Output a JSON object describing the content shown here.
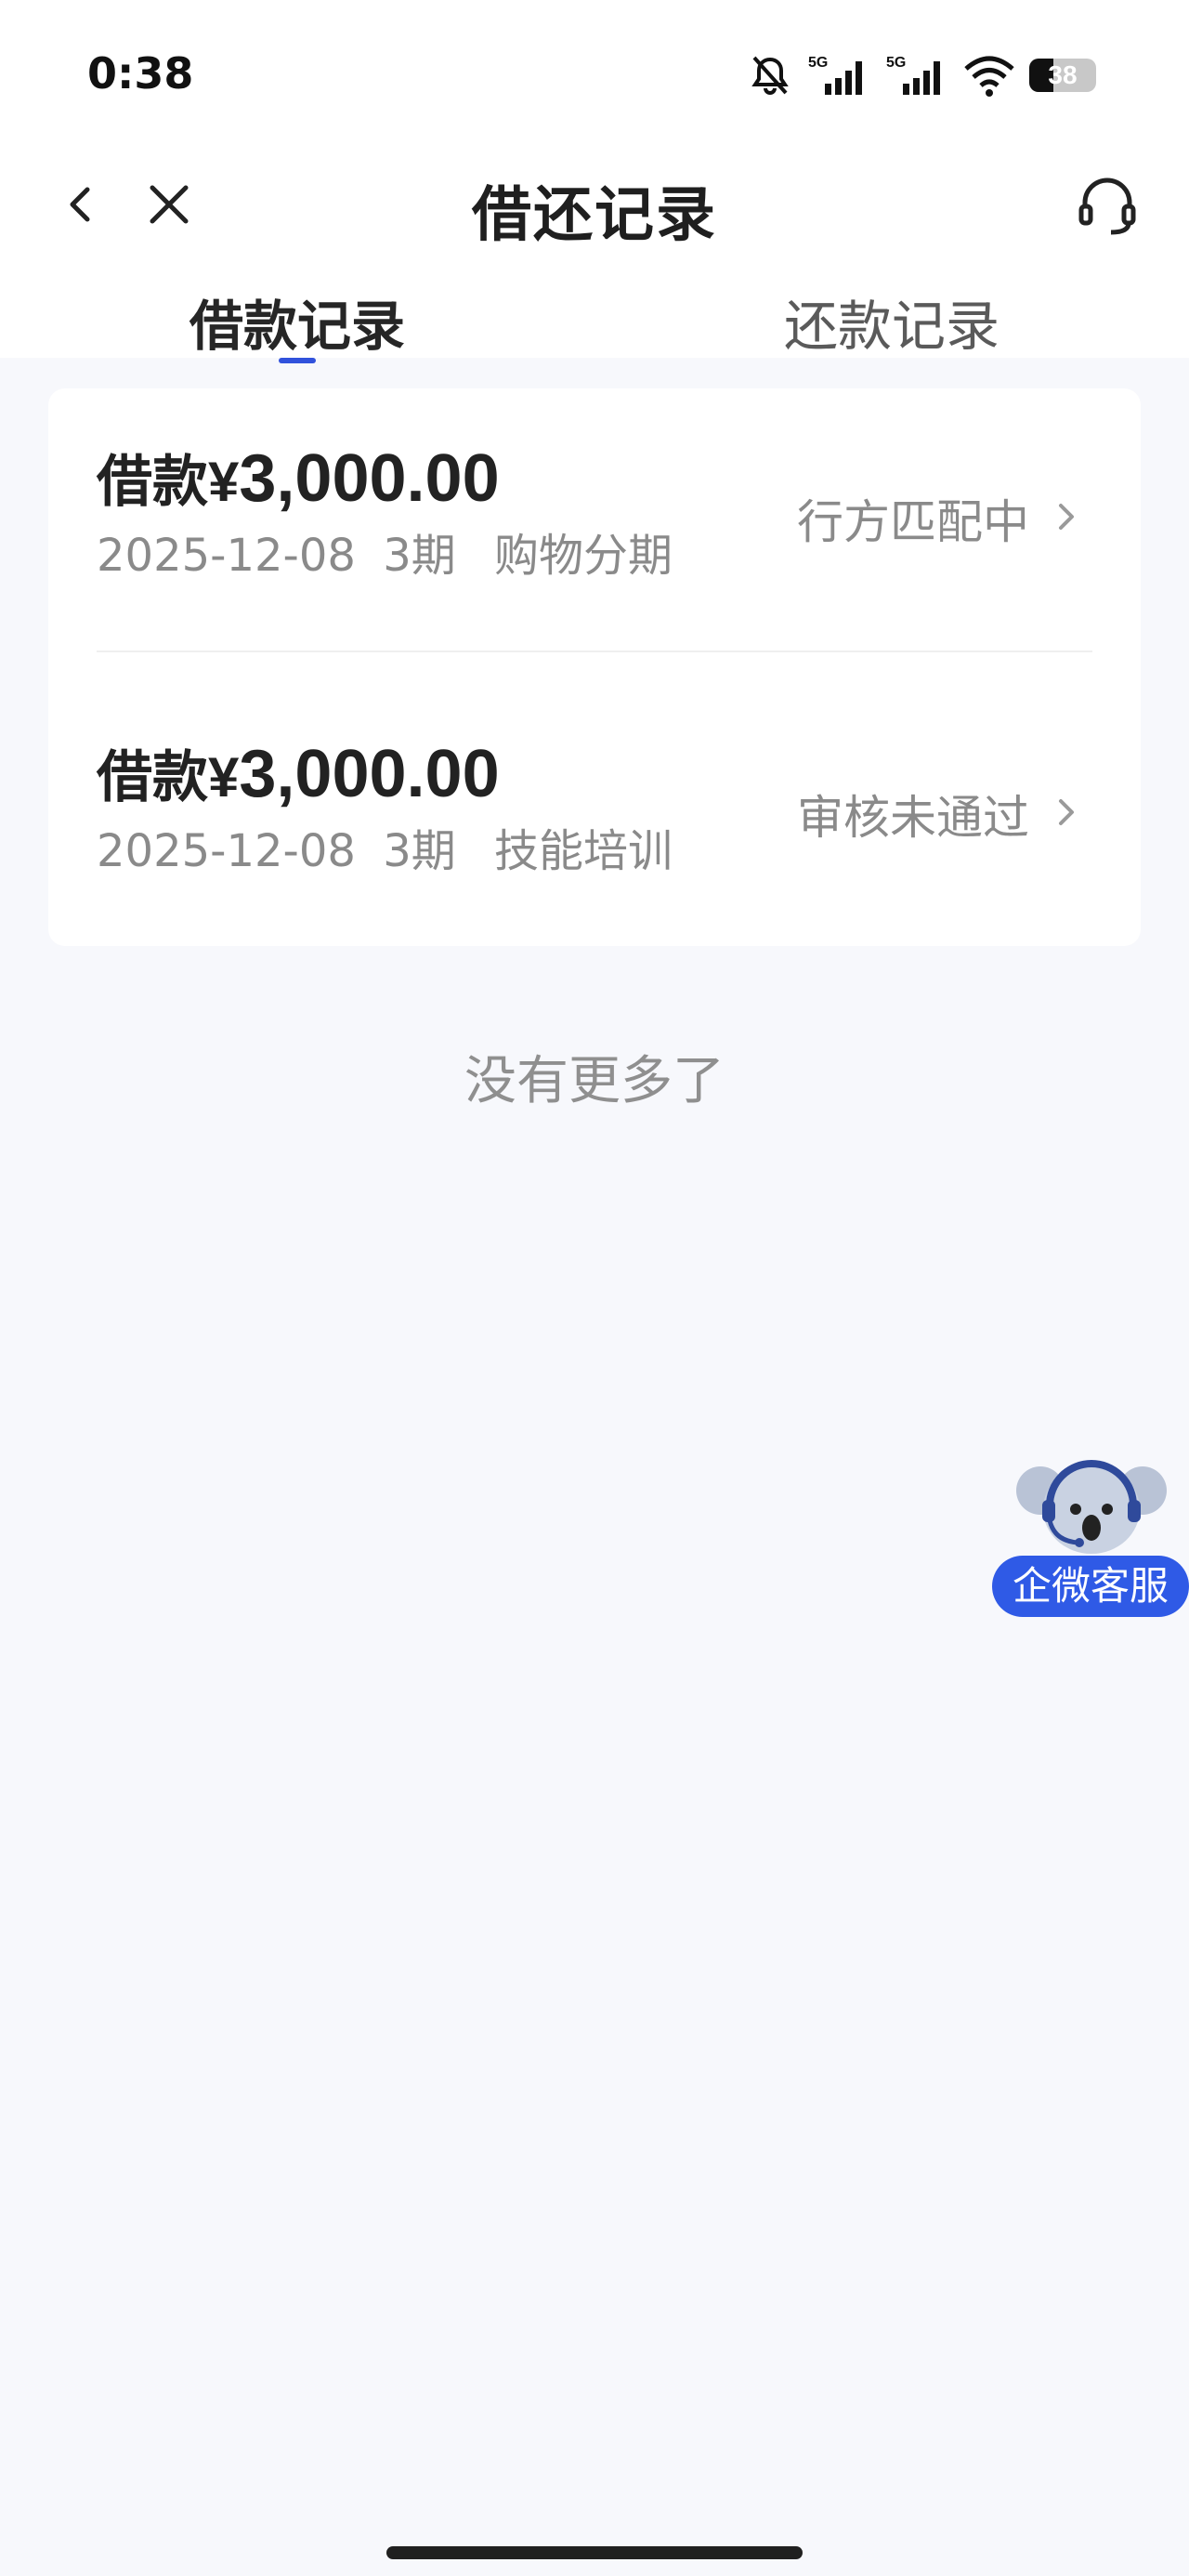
{
  "status": {
    "time": "0:38",
    "battery": "38",
    "signal1_label": "5G",
    "signal2_label": "5G"
  },
  "header": {
    "title": "借还记录",
    "back_icon": "chevron-left-icon",
    "close_icon": "close-icon",
    "service_icon": "headset-icon"
  },
  "tabs": [
    {
      "label": "借款记录",
      "active": true
    },
    {
      "label": "还款记录",
      "active": false
    }
  ],
  "records": [
    {
      "label": "借款",
      "currency": "¥",
      "amount": "3,000.00",
      "date": "2025-12-08",
      "term": "3期",
      "purpose": "购物分期",
      "status": "行方匹配中"
    },
    {
      "label": "借款",
      "currency": "¥",
      "amount": "3,000.00",
      "date": "2025-12-08",
      "term": "3期",
      "purpose": "技能培训",
      "status": "审核未通过"
    }
  ],
  "footer_text": "没有更多了",
  "floating": {
    "label": "企微客服",
    "icon": "koala-mascot-icon"
  },
  "colors": {
    "accent": "#3152dc",
    "badge_blue": "#2f5ae6",
    "background": "#f7f8fc"
  }
}
